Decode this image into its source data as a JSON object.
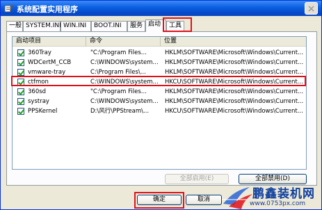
{
  "window": {
    "title": "系统配置实用程序",
    "close_label": "X"
  },
  "tabs": [
    {
      "label": "一般"
    },
    {
      "label": "SYSTEM.INI"
    },
    {
      "label": "WIN.INI"
    },
    {
      "label": "BOOT.INI"
    },
    {
      "label": "服务"
    },
    {
      "label": "启动"
    },
    {
      "label": "工具"
    }
  ],
  "active_tab": "启动",
  "list": {
    "headers": [
      "启动项目",
      "命令",
      "位置"
    ],
    "rows": [
      {
        "item": "360Tray",
        "command": "\"C:\\Program Files...",
        "location": "HKLM\\SOFTWARE\\Microsoft\\Windows\\Current...",
        "checked": true
      },
      {
        "item": "WDCertM_CCB",
        "command": "C:\\WINDOWS\\system...",
        "location": "HKLM\\SOFTWARE\\Microsoft\\Windows\\Current...",
        "checked": true
      },
      {
        "item": "vmware-tray",
        "command": "C:\\Program Files\\...",
        "location": "HKLM\\SOFTWARE\\Microsoft\\Windows\\Current...",
        "checked": true
      },
      {
        "item": "ctfmon",
        "command": "C:\\WINDOWS\\system...",
        "location": "HKCU\\SOFTWARE\\Microsoft\\Windows\\Current...",
        "checked": true
      },
      {
        "item": "360sd",
        "command": "\"C:\\Program Files...",
        "location": "HKLM\\SOFTWARE\\Microsoft\\Windows\\Current...",
        "checked": true
      },
      {
        "item": "systray",
        "command": "C:\\WINDOWS\\system...",
        "location": "HKLM\\SOFTWARE\\Microsoft\\Windows\\Current...",
        "checked": true
      },
      {
        "item": "PPSKernel",
        "command": "D:\\风行\\PPStream\\...",
        "location": "HKCU\\SOFTWARE\\Microsoft\\Windows\\Current...",
        "checked": true
      }
    ]
  },
  "buttons": {
    "enable_all": "全部启用(E)",
    "disable_all": "全部禁用(D)",
    "ok": "确定",
    "cancel": "取消"
  },
  "watermark": {
    "brand": "鹏鑫装机网",
    "url": "www.0753px.com"
  },
  "colors": {
    "highlight": "#e0101a",
    "titlebar": "#0a5ee0"
  }
}
